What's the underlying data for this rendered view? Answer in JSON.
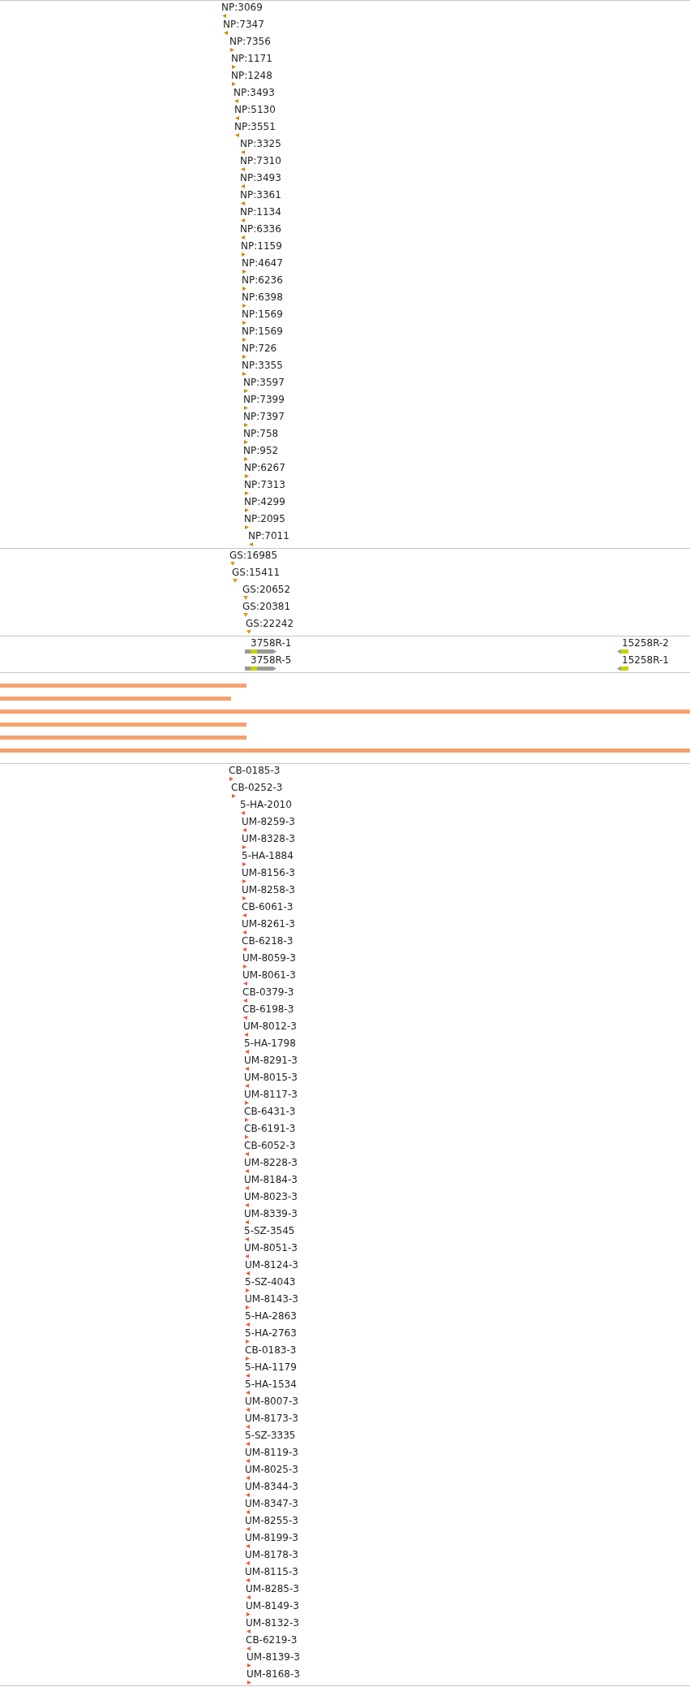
{
  "tracks": [
    {
      "kind": "stranded",
      "color": "#c98a0a",
      "features": [
        {
          "label": "NP:3069",
          "reverse": true
        },
        {
          "label": "NP:7347",
          "reverse": true
        },
        {
          "label": "NP:7356",
          "reverse": false
        },
        {
          "label": "NP:1171",
          "reverse": false
        },
        {
          "label": "NP:1248",
          "reverse": false
        },
        {
          "label": "NP:3493",
          "reverse": true
        },
        {
          "label": "NP:5130",
          "reverse": true
        },
        {
          "label": "NP:3551",
          "reverse": true
        },
        {
          "label": "NP:3325",
          "reverse": true
        },
        {
          "label": "NP:7310",
          "reverse": true
        },
        {
          "label": "NP:3493",
          "reverse": true
        },
        {
          "label": "NP:3361",
          "reverse": true
        },
        {
          "label": "NP:1134",
          "reverse": true
        },
        {
          "label": "NP:6336",
          "reverse": true
        },
        {
          "label": "NP:1159",
          "reverse": false
        },
        {
          "label": "NP:4647",
          "reverse": false
        },
        {
          "label": "NP:6236",
          "reverse": false
        },
        {
          "label": "NP:6398",
          "reverse": false
        },
        {
          "label": "NP:1569",
          "reverse": false
        },
        {
          "label": "NP:1569",
          "reverse": false
        },
        {
          "label": "NP:726",
          "reverse": false
        },
        {
          "label": "NP:3355",
          "reverse": false
        },
        {
          "label": "NP:3597",
          "reverse": false
        },
        {
          "label": "NP:7399",
          "reverse": false
        },
        {
          "label": "NP:7397",
          "reverse": false
        },
        {
          "label": "NP:758",
          "reverse": false
        },
        {
          "label": "NP:952",
          "reverse": false
        },
        {
          "label": "NP:6267",
          "reverse": false
        },
        {
          "label": "NP:7313",
          "reverse": false
        },
        {
          "label": "NP:4299",
          "reverse": false
        },
        {
          "label": "NP:2095",
          "reverse": false
        },
        {
          "label": "NP:7011",
          "reverse": true
        }
      ]
    },
    {
      "kind": "sites",
      "color": "#e39a17",
      "features": [
        {
          "label": "GS:16985"
        },
        {
          "label": "GS:15411"
        },
        {
          "label": "GS:20652"
        },
        {
          "label": "GS:20381"
        },
        {
          "label": "GS:22242"
        }
      ]
    },
    {
      "kind": "genes",
      "rows": [
        {
          "genes": [
            {
              "label": "3758R-1",
              "reverse": false
            },
            {
              "label": "15258R-2",
              "reverse": true
            }
          ]
        },
        {
          "genes": [
            {
              "label": "3758R-5",
              "reverse": false
            },
            {
              "label": "15258R-1",
              "reverse": true
            }
          ]
        }
      ]
    },
    {
      "kind": "bars",
      "bars": [
        {
          "level": 0.357
        },
        {
          "level": 0.335
        },
        {
          "level": 1
        },
        {
          "level": 0.357
        },
        {
          "level": 0.357
        },
        {
          "level": 1
        }
      ]
    },
    {
      "kind": "stranded",
      "color": "#f2573a",
      "features": [
        {
          "label": "CB-0185-3",
          "reverse": false
        },
        {
          "label": "CB-0252-3",
          "reverse": false
        },
        {
          "label": "5-HA-2010",
          "reverse": true
        },
        {
          "label": "UM-8259-3",
          "reverse": true
        },
        {
          "label": "UM-8328-3",
          "reverse": false
        },
        {
          "label": "5-HA-1884",
          "reverse": false
        },
        {
          "label": "UM-8156-3",
          "reverse": false
        },
        {
          "label": "UM-8258-3",
          "reverse": false
        },
        {
          "label": "CB-6061-3",
          "reverse": true
        },
        {
          "label": "UM-8261-3",
          "reverse": true
        },
        {
          "label": "CB-6218-3",
          "reverse": true
        },
        {
          "label": "UM-8059-3",
          "reverse": false
        },
        {
          "label": "UM-8061-3",
          "reverse": true
        },
        {
          "label": "CB-0379-3",
          "reverse": true
        },
        {
          "label": "CB-6198-3",
          "reverse": true
        },
        {
          "label": "UM-8012-3",
          "reverse": true
        },
        {
          "label": "5-HA-1798",
          "reverse": true
        },
        {
          "label": "UM-8291-3",
          "reverse": true
        },
        {
          "label": "UM-8015-3",
          "reverse": true
        },
        {
          "label": "UM-8117-3",
          "reverse": false
        },
        {
          "label": "CB-6431-3",
          "reverse": false
        },
        {
          "label": "CB-6191-3",
          "reverse": false
        },
        {
          "label": "CB-6052-3",
          "reverse": true
        },
        {
          "label": "UM-8228-3",
          "reverse": true
        },
        {
          "label": "UM-8184-3",
          "reverse": true
        },
        {
          "label": "UM-8023-3",
          "reverse": true
        },
        {
          "label": "UM-8339-3",
          "reverse": true
        },
        {
          "label": "5-SZ-3545",
          "reverse": true
        },
        {
          "label": "UM-8051-3",
          "reverse": true
        },
        {
          "label": "UM-8124-3",
          "reverse": true
        },
        {
          "label": "5-SZ-4043",
          "reverse": false
        },
        {
          "label": "UM-8143-3",
          "reverse": false
        },
        {
          "label": "5-HA-2863",
          "reverse": true
        },
        {
          "label": "5-HA-2763",
          "reverse": false
        },
        {
          "label": "CB-0183-3",
          "reverse": false
        },
        {
          "label": "5-HA-1179",
          "reverse": true
        },
        {
          "label": "5-HA-1534",
          "reverse": true
        },
        {
          "label": "UM-8007-3",
          "reverse": true
        },
        {
          "label": "UM-8173-3",
          "reverse": true
        },
        {
          "label": "5-SZ-3335",
          "reverse": true
        },
        {
          "label": "UM-8119-3",
          "reverse": true
        },
        {
          "label": "UM-8025-3",
          "reverse": true
        },
        {
          "label": "UM-8344-3",
          "reverse": true
        },
        {
          "label": "UM-8347-3",
          "reverse": true
        },
        {
          "label": "UM-8255-3",
          "reverse": true
        },
        {
          "label": "UM-8199-3",
          "reverse": true
        },
        {
          "label": "UM-8178-3",
          "reverse": true
        },
        {
          "label": "UM-8115-3",
          "reverse": true
        },
        {
          "label": "UM-8285-3",
          "reverse": true
        },
        {
          "label": "UM-8149-3",
          "reverse": false
        },
        {
          "label": "UM-8132-3",
          "reverse": true
        },
        {
          "label": "CB-6219-3",
          "reverse": true
        },
        {
          "label": "UM-8139-3",
          "reverse": false
        },
        {
          "label": "UM-8168-3",
          "reverse": false
        }
      ]
    }
  ]
}
